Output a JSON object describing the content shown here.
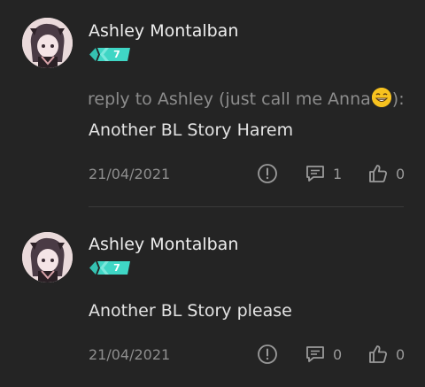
{
  "comments": [
    {
      "username": "Ashley Montalban",
      "level": "7",
      "reply_prefix": "reply to Ashley (just call me Anna",
      "reply_suffix": "):",
      "text": "Another BL Story Harem",
      "date": "21/04/2021",
      "report_icon": "exclamation-circle-icon",
      "reply_count": "1",
      "like_count": "0"
    },
    {
      "username": "Ashley Montalban",
      "level": "7",
      "text": "Another BL Story please",
      "date": "21/04/2021",
      "report_icon": "exclamation-circle-icon",
      "reply_count": "0",
      "like_count": "0"
    }
  ],
  "colors": {
    "background": "#242424",
    "badge": "#3fd6c5",
    "divider": "#3a3a3a"
  }
}
